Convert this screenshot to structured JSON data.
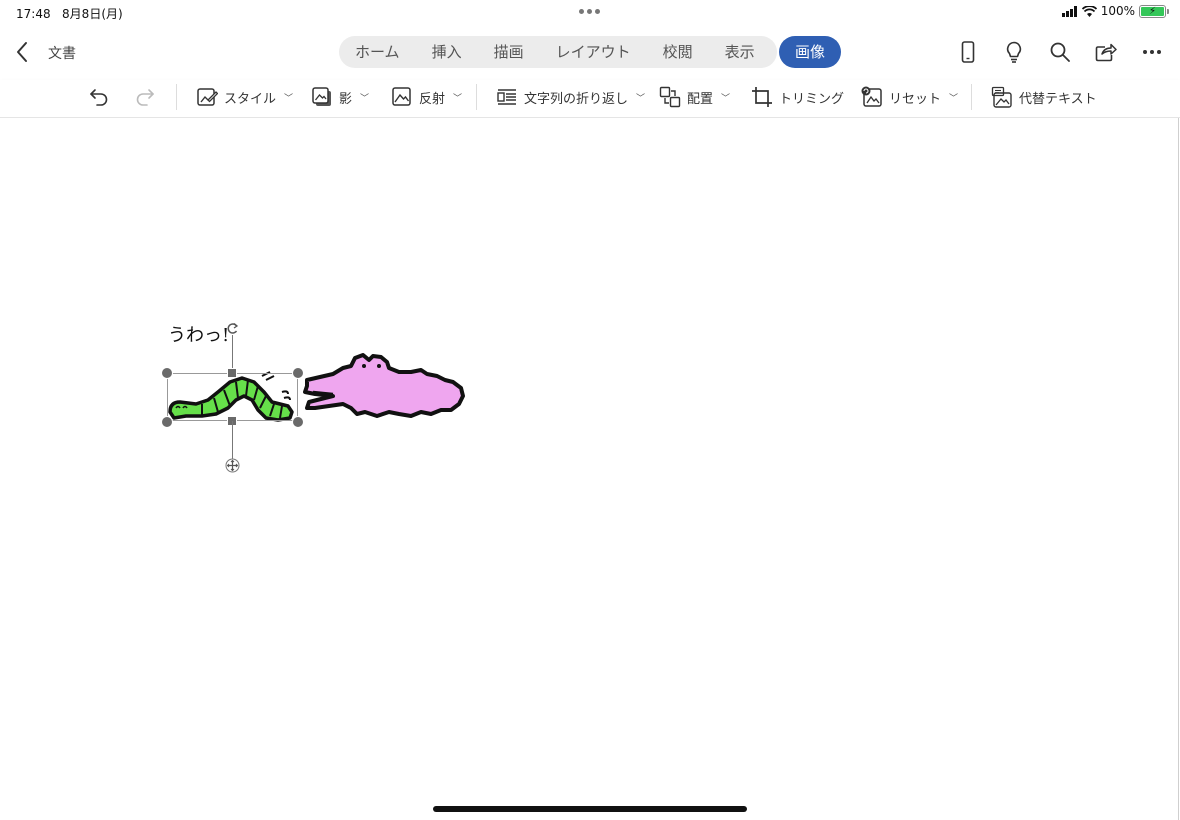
{
  "status_bar": {
    "time": "17:48",
    "date": "8月8日(月)",
    "battery_pct": "100%",
    "battery_color": "#34c759"
  },
  "header": {
    "back_icon": "chevron-left-icon",
    "doc_title": "文書",
    "tabs": [
      {
        "label": "ホーム"
      },
      {
        "label": "挿入"
      },
      {
        "label": "描画"
      },
      {
        "label": "レイアウト"
      },
      {
        "label": "校閲"
      },
      {
        "label": "表示"
      },
      {
        "label": "画像",
        "active": true
      }
    ],
    "active_color": "#2f5fb3",
    "right_icons": [
      "phone-icon",
      "lightbulb-icon",
      "search-icon",
      "share-icon",
      "more-icon"
    ]
  },
  "toolbar": {
    "undo_icon": "undo-icon",
    "redo_icon": "redo-icon",
    "items": [
      {
        "label": "スタイル",
        "icon": "style-icon",
        "dropdown": true
      },
      {
        "label": "影",
        "icon": "shadow-icon",
        "dropdown": true
      },
      {
        "label": "反射",
        "icon": "reflection-icon",
        "dropdown": true
      },
      {
        "label": "文字列の折り返し",
        "icon": "wrap-text-icon",
        "dropdown": true
      },
      {
        "label": "配置",
        "icon": "arrange-icon",
        "dropdown": true
      },
      {
        "label": "トリミング",
        "icon": "crop-icon",
        "dropdown": false
      },
      {
        "label": "リセット",
        "icon": "reset-picture-icon",
        "dropdown": true
      },
      {
        "label": "代替テキスト",
        "icon": "alt-text-icon",
        "dropdown": false
      }
    ]
  },
  "document": {
    "text": "うわっ!",
    "images": [
      "green-caterpillar-image",
      "pink-crocodile-image"
    ]
  }
}
